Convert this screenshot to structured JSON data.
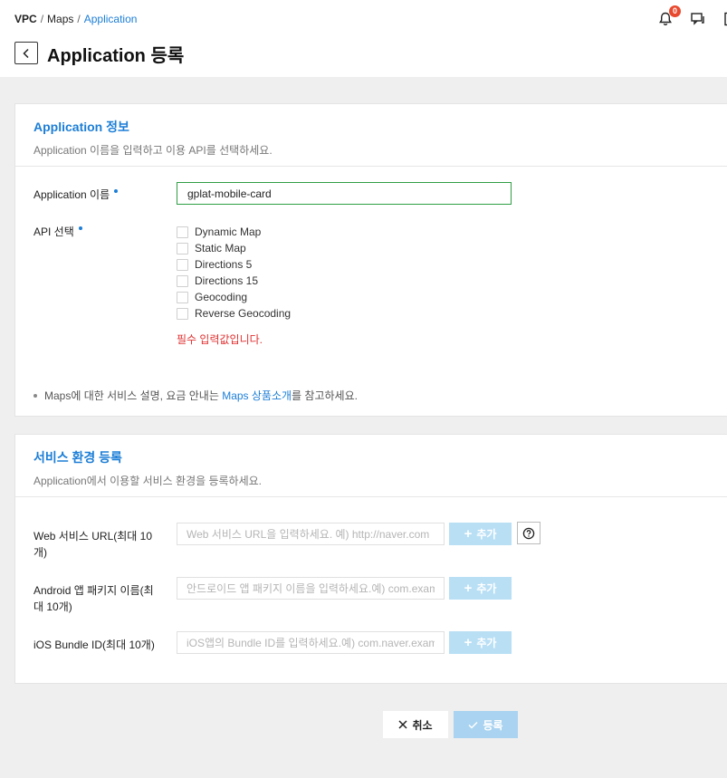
{
  "breadcrumb": {
    "root": "VPC",
    "middle": "Maps",
    "current": "Application"
  },
  "header": {
    "notification_count": "0"
  },
  "page": {
    "title": "Application 등록"
  },
  "app_info": {
    "title": "Application 정보",
    "description": "Application 이름을 입력하고 이용 API를 선택하세요.",
    "name_label": "Application 이름",
    "name_value": "gplat-mobile-card",
    "api_label": "API 선택",
    "apis": [
      "Dynamic Map",
      "Static Map",
      "Directions 5",
      "Directions 15",
      "Geocoding",
      "Reverse Geocoding"
    ],
    "error": "필수 입력값입니다.",
    "note_prefix": "Maps에 대한 서비스 설명, 요금 안내는 ",
    "note_link": "Maps 상품소개",
    "note_suffix": "를 참고하세요."
  },
  "service_env": {
    "title": "서비스 환경 등록",
    "description": "Application에서 이용할 서비스 환경을 등록하세요.",
    "add_label": "추가",
    "web": {
      "label": "Web 서비스 URL(최대 10개)",
      "placeholder": "Web 서비스 URL을 입력하세요. 예) http://naver.com"
    },
    "android": {
      "label": "Android 앱 패키지 이름(최대 10개)",
      "placeholder": "안드로이드 앱 패키지 이름을 입력하세요.예) com.example.app"
    },
    "ios": {
      "label": "iOS Bundle ID(최대 10개)",
      "placeholder": "iOS앱의 Bundle ID를 입력하세요.예) com.naver.example"
    }
  },
  "actions": {
    "cancel": "취소",
    "submit": "등록"
  },
  "colors": {
    "accent": "#1c7ed6",
    "error": "#e03131",
    "valid_border": "#2f9e44",
    "disabled_button": "#b9dff5"
  }
}
